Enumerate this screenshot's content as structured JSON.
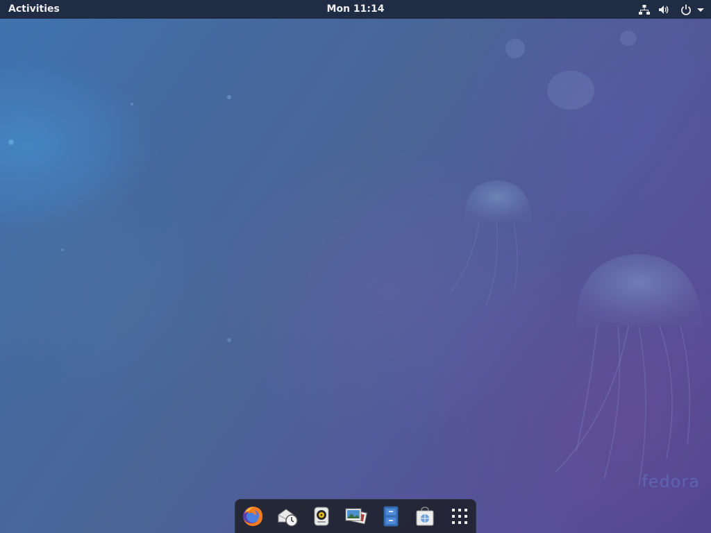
{
  "topbar": {
    "activities_label": "Activities",
    "clock": "Mon 11:14",
    "tray_icons": [
      "network-wired-icon",
      "volume-icon",
      "power-icon",
      "menu-arrow-icon"
    ]
  },
  "desktop": {
    "watermark": "fedora"
  },
  "dash": {
    "items": [
      {
        "name": "firefox-icon"
      },
      {
        "name": "evolution-icon"
      },
      {
        "name": "rhythmbox-icon"
      },
      {
        "name": "shotwell-icon"
      },
      {
        "name": "files-icon"
      },
      {
        "name": "software-icon"
      },
      {
        "name": "show-applications-icon"
      }
    ]
  },
  "colors": {
    "topbar": "#1f2c44",
    "dash": "#1c1e26",
    "firefox_orange": "#f57c20",
    "files_blue": "#3c78c8"
  }
}
